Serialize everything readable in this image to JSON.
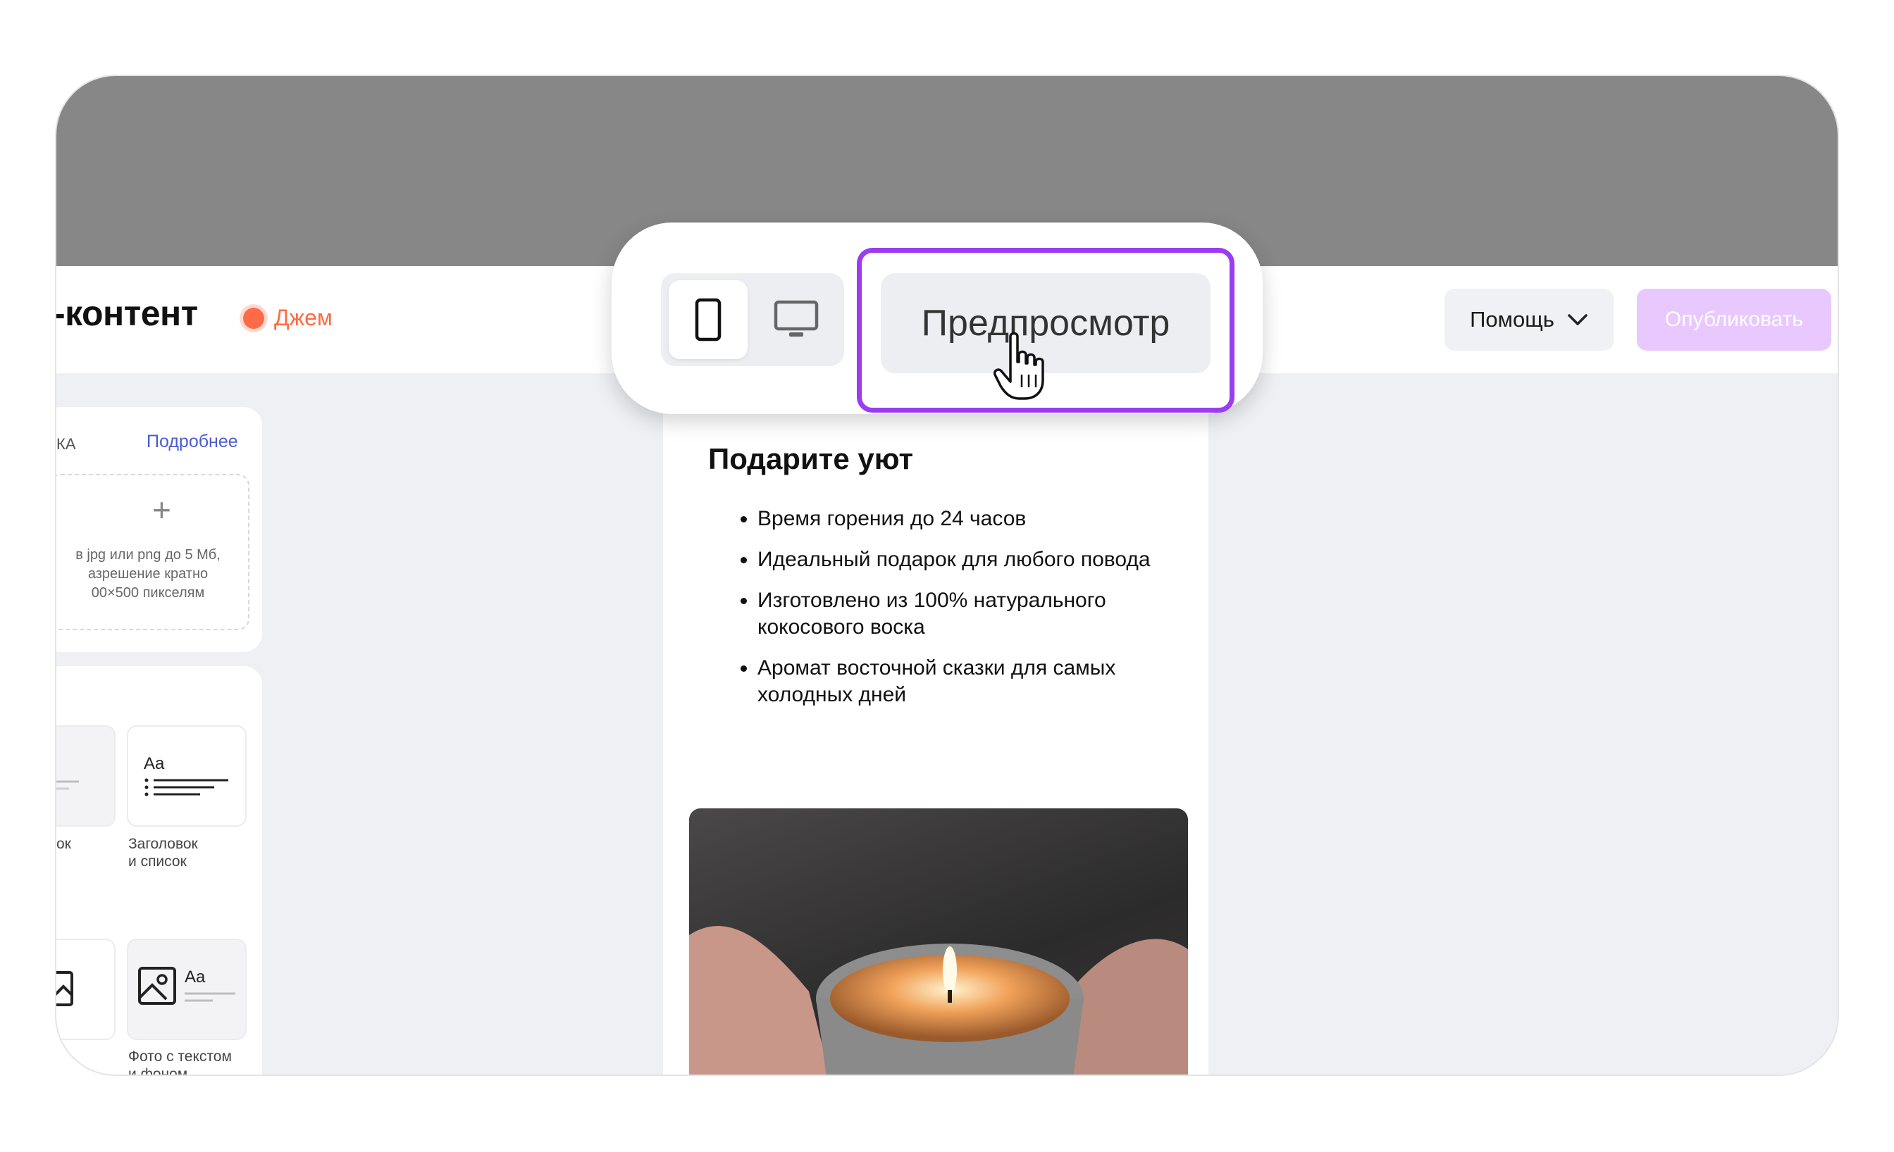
{
  "header": {
    "title": "-контент",
    "status_label": "Джем",
    "help_label": "Помощь",
    "publish_label": "Опубликовать"
  },
  "toolbar": {
    "preview_label": "Предпросмотр",
    "mobile_icon": "phone-icon",
    "desktop_icon": "monitor-icon"
  },
  "sidebar": {
    "section_label": "КА",
    "more_link": "Подробнее",
    "upload_hint": "в jpg или png до 5 Мб,\nазрешение кратно\n00×500 пикселям",
    "tiles": [
      {
        "caption": "ок"
      },
      {
        "caption": "Заголовок\nи список"
      },
      {
        "caption": ""
      },
      {
        "caption": "Фото с текстом\nи фоном"
      }
    ]
  },
  "content": {
    "title": "Подарите уют",
    "bullets": [
      "Время горения до 24 часов",
      "Идеальный подарок для любого повода",
      "Изготовлено из 100% натурального кокосового воска",
      "Аромат восточной сказки для самых холодных дней"
    ]
  },
  "colors": {
    "accent": "#9a3df0",
    "status": "#ff6b46",
    "publish_disabled": "#e9c8ff",
    "link": "#4c5bd4"
  }
}
